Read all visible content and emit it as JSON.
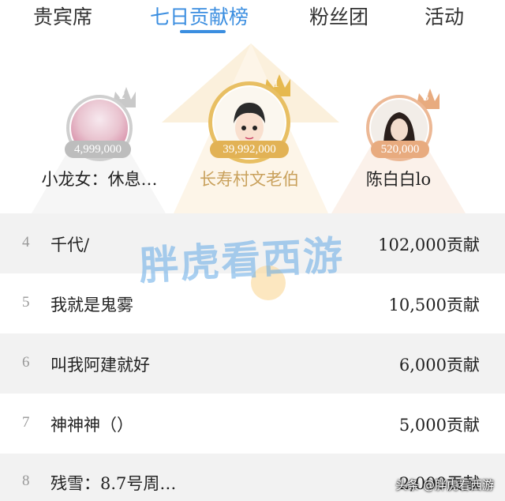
{
  "tabs": [
    {
      "label": "贵宾席"
    },
    {
      "label": "七日贡献榜"
    },
    {
      "label": "粉丝团"
    },
    {
      "label": "活动"
    }
  ],
  "podium": [
    {
      "rank": "2",
      "name": "小龙女：休息…",
      "value": "4,999,000"
    },
    {
      "rank": "1",
      "name": "长寿村文老伯",
      "value": "39,992,000"
    },
    {
      "rank": "3",
      "name": "陈白白lo",
      "value": "520,000"
    }
  ],
  "list": [
    {
      "rank": "4",
      "name": "千代/",
      "value": "102,000贡献"
    },
    {
      "rank": "5",
      "name": "我就是鬼雾",
      "value": "10,500贡献"
    },
    {
      "rank": "6",
      "name": "叫我阿建就好",
      "value": "6,000贡献"
    },
    {
      "rank": "7",
      "name": "神神神（）",
      "value": "5,000贡献"
    },
    {
      "rank": "8",
      "name": "残雪：8.7号周…",
      "value": "2,000贡献"
    }
  ],
  "watermark": "胖虎看西游",
  "credit": "头条 @胖虎看西游",
  "colors": {
    "accent": "#3b8ee0",
    "gold": "#d9a441",
    "silver": "#b8b8b8",
    "bronze": "#e0a07a"
  }
}
